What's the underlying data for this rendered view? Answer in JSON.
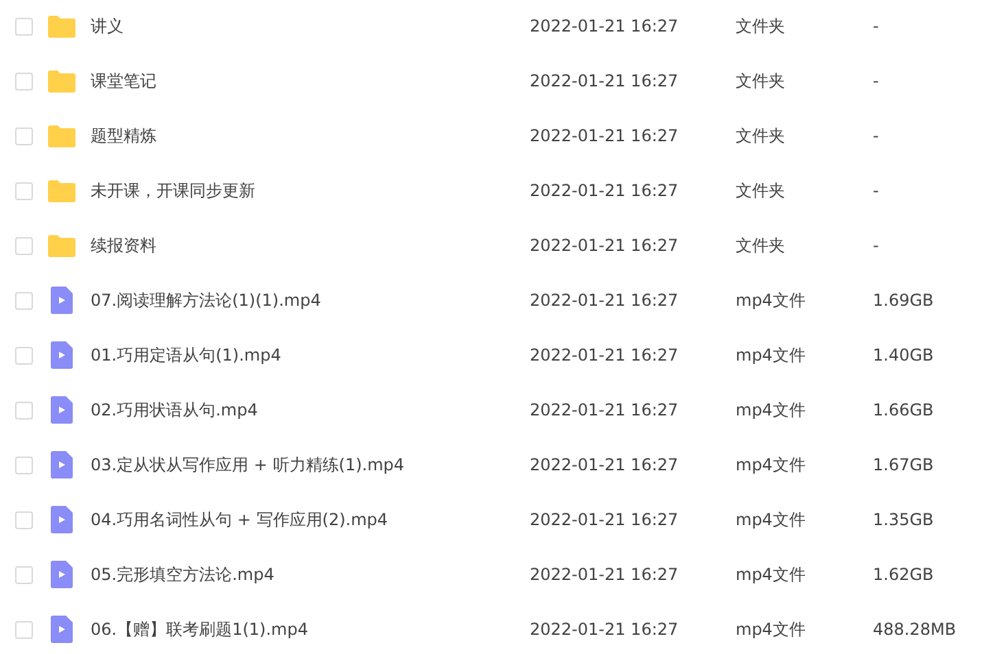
{
  "files": [
    {
      "kind": "folder",
      "checked": false,
      "name": "讲义",
      "modified": "2022-01-21 16:27",
      "type": "文件夹",
      "size": "-"
    },
    {
      "kind": "folder",
      "checked": false,
      "name": "课堂笔记",
      "modified": "2022-01-21 16:27",
      "type": "文件夹",
      "size": "-"
    },
    {
      "kind": "folder",
      "checked": false,
      "name": "题型精炼",
      "modified": "2022-01-21 16:27",
      "type": "文件夹",
      "size": "-"
    },
    {
      "kind": "folder",
      "checked": false,
      "name": "未开课，开课同步更新",
      "modified": "2022-01-21 16:27",
      "type": "文件夹",
      "size": "-"
    },
    {
      "kind": "folder",
      "checked": false,
      "name": "续报资料",
      "modified": "2022-01-21 16:27",
      "type": "文件夹",
      "size": "-"
    },
    {
      "kind": "video",
      "checked": false,
      "name": "07.阅读理解方法论(1)(1).mp4",
      "modified": "2022-01-21 16:27",
      "type": "mp4文件",
      "size": "1.69GB"
    },
    {
      "kind": "video",
      "checked": false,
      "name": "01.巧用定语从句(1).mp4",
      "modified": "2022-01-21 16:27",
      "type": "mp4文件",
      "size": "1.40GB"
    },
    {
      "kind": "video",
      "checked": false,
      "name": "02.巧用状语从句.mp4",
      "modified": "2022-01-21 16:27",
      "type": "mp4文件",
      "size": "1.66GB"
    },
    {
      "kind": "video",
      "checked": false,
      "name": "03.定从状从写作应用 + 听力精练(1).mp4",
      "modified": "2022-01-21 16:27",
      "type": "mp4文件",
      "size": "1.67GB"
    },
    {
      "kind": "video",
      "checked": false,
      "name": "04.巧用名词性从句 + 写作应用(2).mp4",
      "modified": "2022-01-21 16:27",
      "type": "mp4文件",
      "size": "1.35GB"
    },
    {
      "kind": "video",
      "checked": false,
      "name": "05.完形填空方法论.mp4",
      "modified": "2022-01-21 16:27",
      "type": "mp4文件",
      "size": "1.62GB"
    },
    {
      "kind": "video",
      "checked": false,
      "name": "06.【赠】联考刷题1(1).mp4",
      "modified": "2022-01-21 16:27",
      "type": "mp4文件",
      "size": "488.28MB"
    }
  ]
}
